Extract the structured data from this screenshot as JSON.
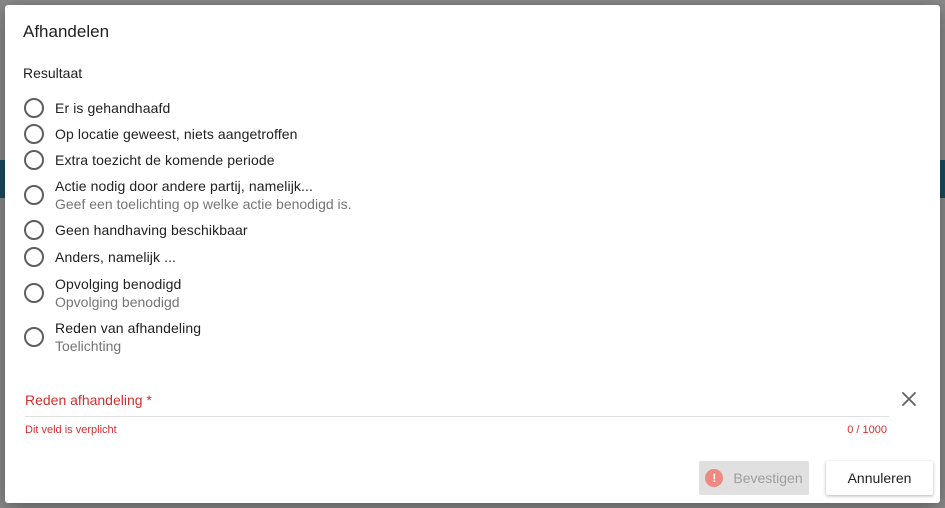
{
  "dialog": {
    "title": "Afhandelen",
    "section_label": "Resultaat",
    "options": [
      {
        "label": "Er is gehandhaafd",
        "hint": ""
      },
      {
        "label": "Op locatie geweest, niets aangetroffen",
        "hint": ""
      },
      {
        "label": "Extra toezicht de komende periode",
        "hint": ""
      },
      {
        "label": "Actie nodig door andere partij, namelijk...",
        "hint": "Geef een toelichting op welke actie benodigd is."
      },
      {
        "label": "Geen handhaving beschikbaar",
        "hint": ""
      },
      {
        "label": "Anders, namelijk ...",
        "hint": ""
      },
      {
        "label": "Opvolging benodigd",
        "hint": "Opvolging benodigd"
      },
      {
        "label": "Reden van afhandeling",
        "hint": "Toelichting"
      }
    ],
    "field": {
      "label": "Reden afhandeling *",
      "value": "",
      "error": "Dit veld is verplicht",
      "counter": "0 / 1000"
    },
    "buttons": {
      "confirm": "Bevestigen",
      "confirm_warning_glyph": "!",
      "cancel": "Annuleren"
    }
  },
  "colors": {
    "error": "#d32f2f",
    "disabled_button": "#e0e0e0",
    "warning_icon": "#ef8a80"
  }
}
